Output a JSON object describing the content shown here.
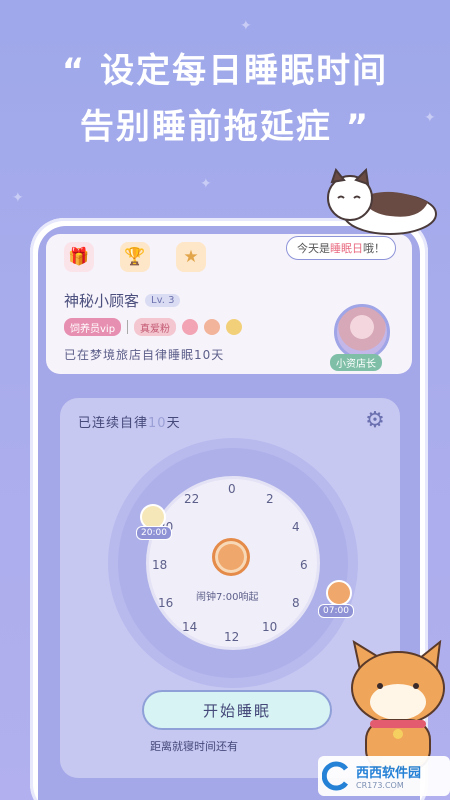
{
  "headline": {
    "line1": "“ 设定每日睡眠时间",
    "line2": "告别睡前拖延症 ”"
  },
  "speech_bubble": {
    "prefix": "今天是",
    "highlight": "睡眠日",
    "suffix": "哦！"
  },
  "profile": {
    "name": "神秘小顾客",
    "level": "Lv. 3",
    "badge_vip": "饲养员vip",
    "badge_fan": "真爱粉",
    "status": "已在梦境旅店自律睡眠10天",
    "role_tag": "小资店长"
  },
  "sleep_card": {
    "streak_prefix": "已连续自律",
    "streak_num": "10",
    "streak_suffix": "天",
    "clock_numbers": [
      "0",
      "2",
      "4",
      "6",
      "8",
      "10",
      "12",
      "14",
      "16",
      "18",
      "20",
      "22"
    ],
    "alarm_text": "闹钟7:00响起",
    "bedtime": "20:00",
    "wake_time": "07:00",
    "start_button": "开始睡眠",
    "countdown": "距离就寝时间还有"
  },
  "watermark": {
    "brand": "西西",
    "suffix": "软件园",
    "site": "CR173.COM"
  },
  "icons": [
    "gift-icon",
    "trophy-icon",
    "bookmark-star-icon",
    "gear-icon",
    "alarm-clock-icon"
  ],
  "colors": {
    "background": "#a4a7e8",
    "accent_pink": "#e86a80",
    "button_fill": "#d7f3f3"
  }
}
